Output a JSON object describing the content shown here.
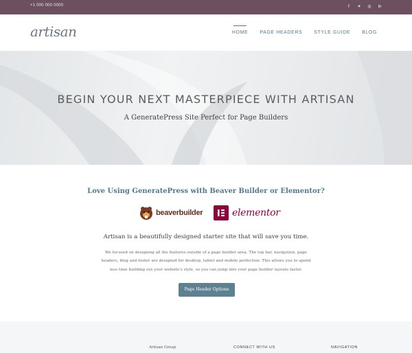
{
  "topbar": {
    "phone": "+1 000 000 0000",
    "social": [
      {
        "icon": "facebook-icon",
        "glyph": "f"
      },
      {
        "icon": "twitter-icon",
        "glyph": "✶"
      },
      {
        "icon": "instagram-icon",
        "glyph": "◎"
      },
      {
        "icon": "linkedin-icon",
        "glyph": "in"
      }
    ],
    "background": "#6d505f"
  },
  "header": {
    "logo": "artisan",
    "nav": [
      "HOME",
      "PAGE HEADERS",
      "STYLE GUIDE",
      "BLOG"
    ],
    "active_nav": "HOME"
  },
  "hero": {
    "title": "BEGIN YOUR NEXT MASTERPIECE WITH ARTISAN",
    "subtitle": "A GeneratePress Site Perfect for Page Builders"
  },
  "content": {
    "love_heading": "Love Using GeneratePress with Beaver Builder or Elementor?",
    "beaver_builder_logo": "beaverbuilder",
    "elementor_logo": "elementor",
    "intro": "Artisan is a beautifully designed starter site that will save you time.",
    "paragraph": "We focused on designing all the features outside of a page builder area. The top bar, navigation, page headers, blog and footer are designed for desktop, tablet and mobile perfection. This allows you to spend less time building out your website's style, so you can jump into your page builder layouts faster.",
    "button": "Page Header Options",
    "accent_color": "#5d8191"
  },
  "footer": {
    "col1": "Artisan Group",
    "col2": "CONNECT WITH US",
    "col3": "NAVIGATION"
  }
}
